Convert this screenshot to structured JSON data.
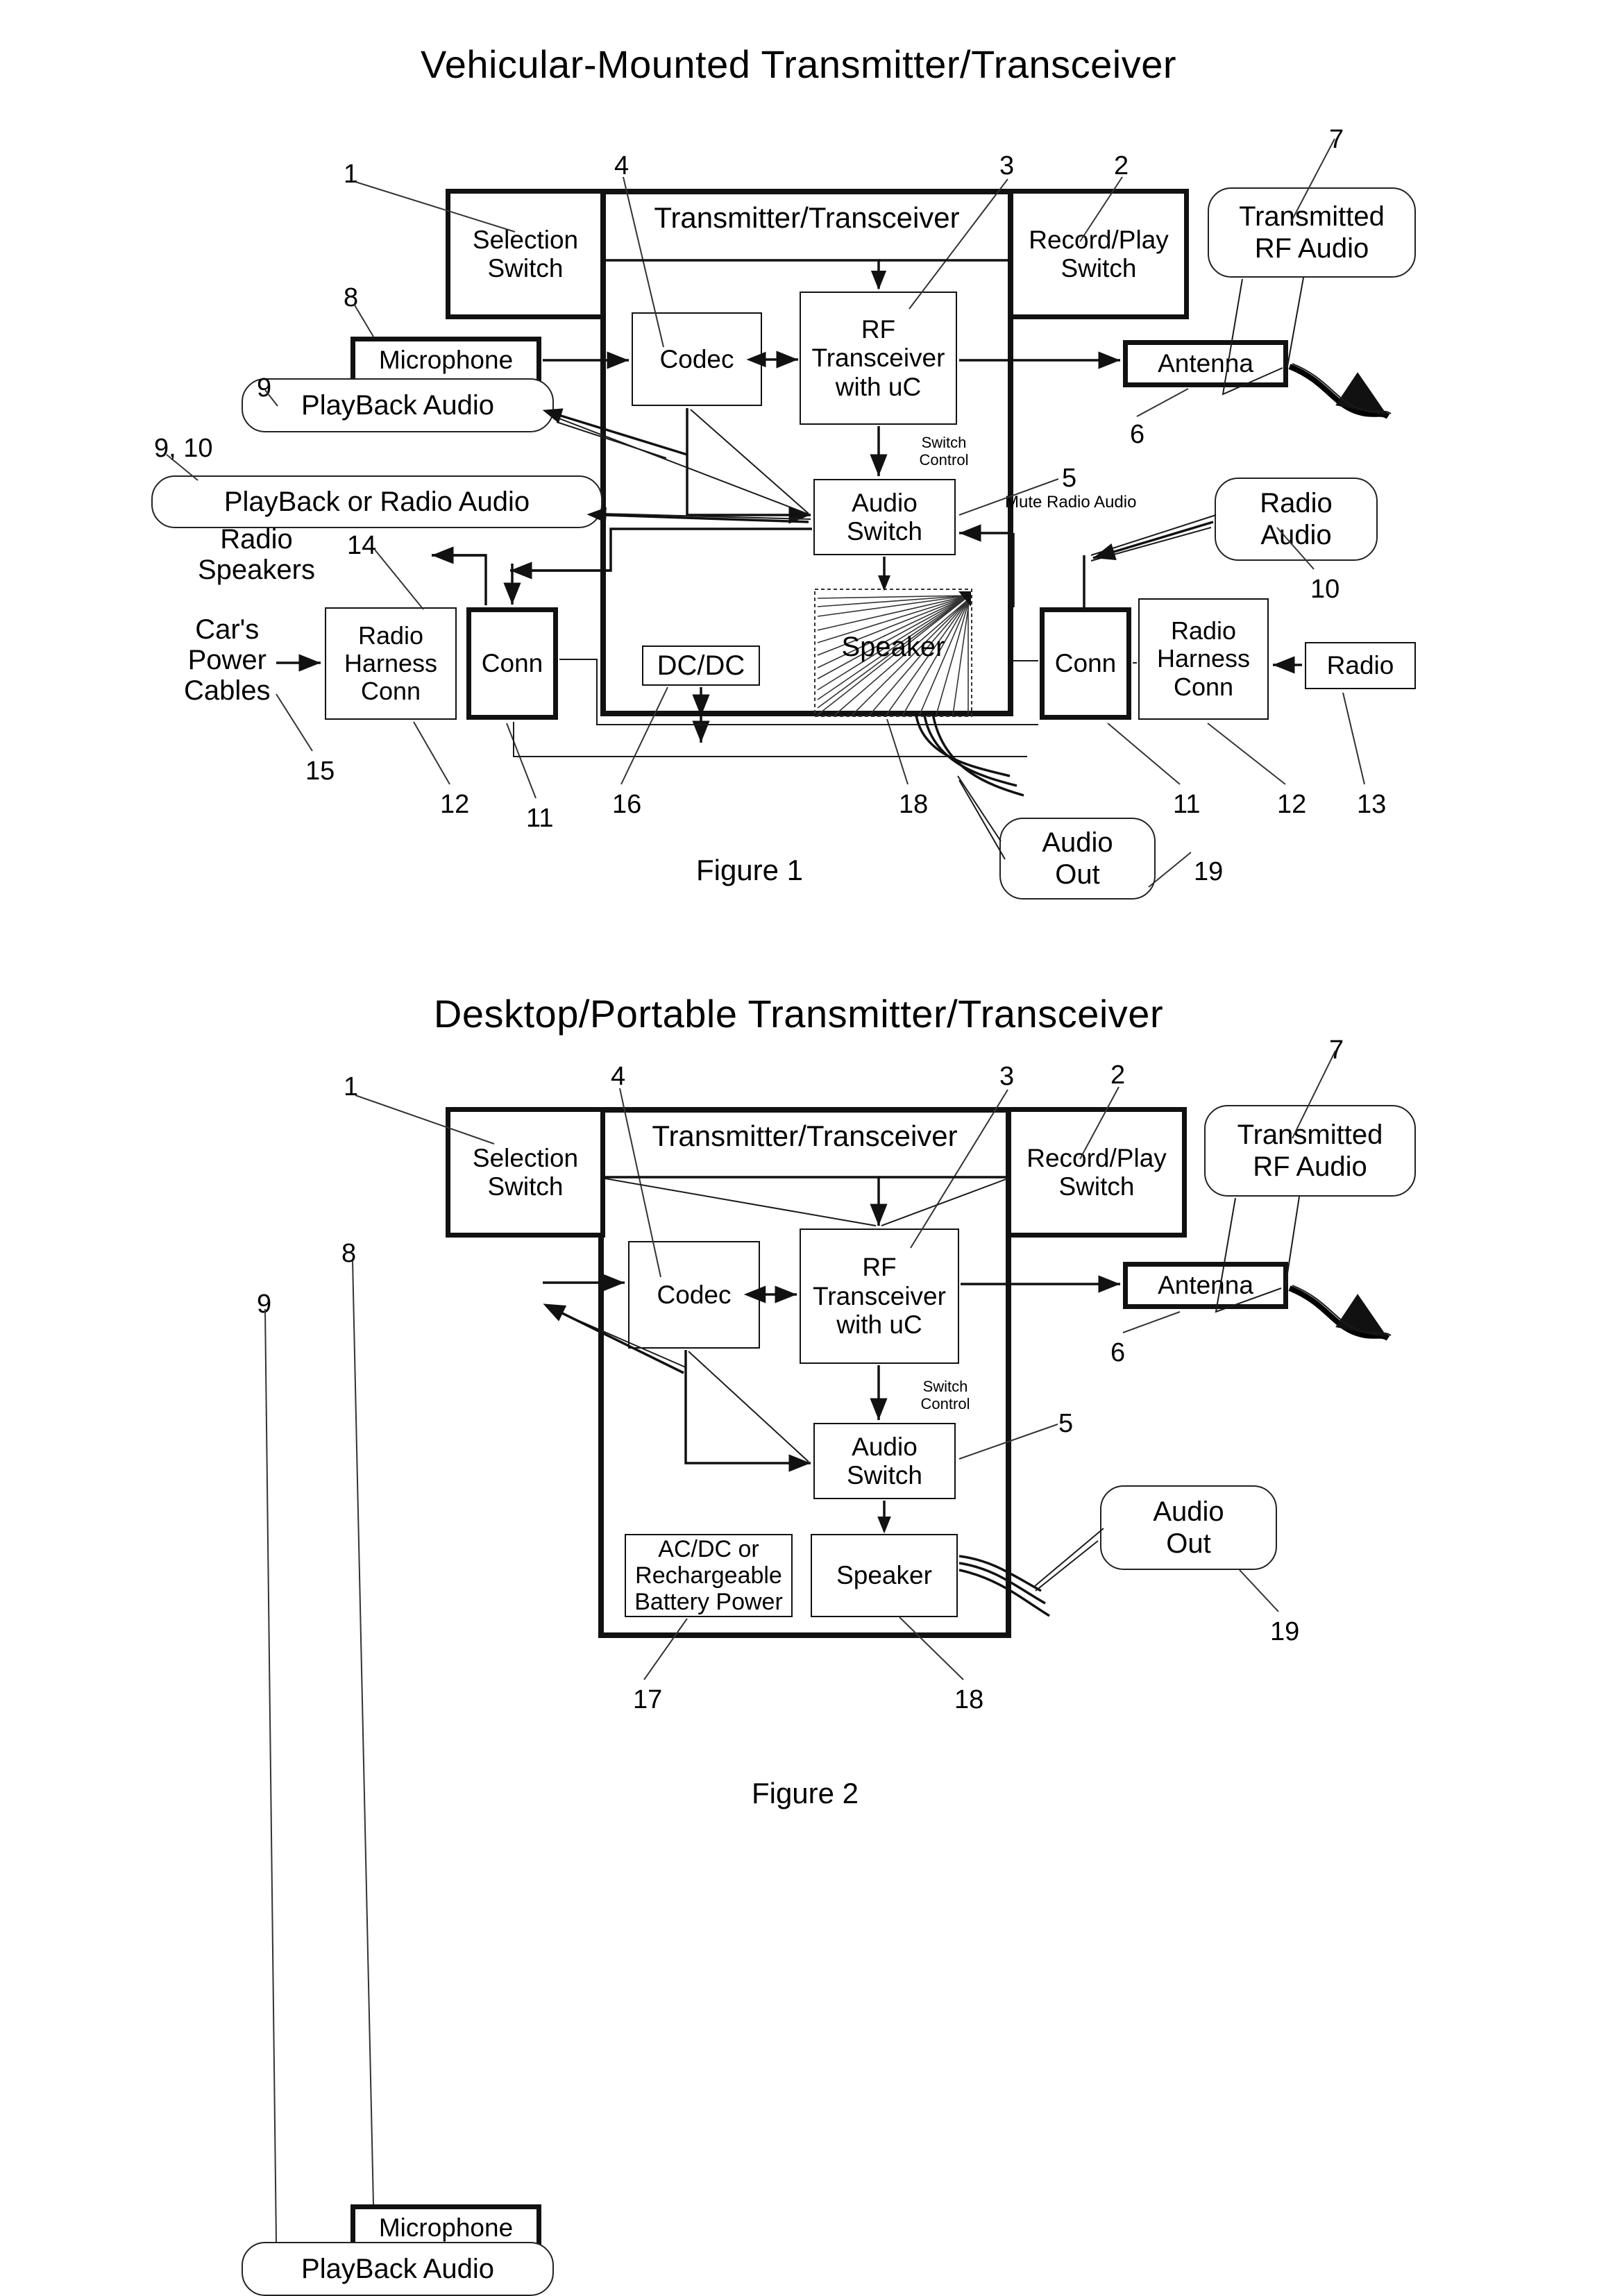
{
  "figure1": {
    "title": "Vehicular-Mounted Transmitter/Transceiver",
    "caption": "Figure 1",
    "outer_box_label": "Transmitter/Transceiver",
    "blocks": {
      "selection_switch": "Selection\nSwitch",
      "record_play_switch": "Record/Play\nSwitch",
      "microphone": "Microphone",
      "codec": "Codec",
      "rf_transceiver": "RF\nTransceiver\nwith uC",
      "audio_switch": "Audio\nSwitch",
      "antenna": "Antenna",
      "speaker": "Speaker",
      "dcdc": "DC/DC",
      "conn_left": "Conn",
      "conn_right": "Conn",
      "radio_harness_conn_left": "Radio\nHarness\nConn",
      "radio_harness_conn_right": "Radio\nHarness\nConn",
      "radio": "Radio"
    },
    "callouts": {
      "transmitted_rf_audio": "Transmitted\nRF Audio",
      "playback_audio": "PlayBack  Audio",
      "playback_or_radio_audio": "PlayBack  or  Radio  Audio",
      "radio_audio": "Radio\nAudio",
      "audio_out": "Audio\nOut"
    },
    "annotations": {
      "switch_control": "Switch\nControl",
      "mute_radio_audio": "Mute Radio Audio",
      "radio_speakers": "Radio\nSpeakers",
      "cars_power_cables": "Car's\nPower\nCables"
    },
    "ref_numerals": {
      "n1": "1",
      "n2": "2",
      "n3": "3",
      "n4": "4",
      "n5": "5",
      "n6": "6",
      "n7": "7",
      "n8": "8",
      "n9": "9",
      "n9_10": "9, 10",
      "n10": "10",
      "n11_left": "11",
      "n11_right": "11",
      "n12_left": "12",
      "n12_right": "12",
      "n13": "13",
      "n14": "14",
      "n15": "15",
      "n16": "16",
      "n18": "18",
      "n19": "19"
    }
  },
  "figure2": {
    "title": "Desktop/Portable Transmitter/Transceiver",
    "caption": "Figure 2",
    "outer_box_label": "Transmitter/Transceiver",
    "blocks": {
      "selection_switch": "Selection\nSwitch",
      "record_play_switch": "Record/Play\nSwitch",
      "microphone": "Microphone",
      "codec": "Codec",
      "rf_transceiver": "RF\nTransceiver\nwith uC",
      "audio_switch": "Audio\nSwitch",
      "antenna": "Antenna",
      "speaker": "Speaker",
      "power": "AC/DC or\nRechargeable\nBattery Power"
    },
    "callouts": {
      "transmitted_rf_audio": "Transmitted\nRF Audio",
      "playback_audio": "PlayBack  Audio",
      "audio_out": "Audio\nOut"
    },
    "annotations": {
      "switch_control": "Switch\nControl"
    },
    "ref_numerals": {
      "n1": "1",
      "n2": "2",
      "n3": "3",
      "n4": "4",
      "n5": "5",
      "n6": "6",
      "n7": "7",
      "n8": "8",
      "n9": "9",
      "n17": "17",
      "n18": "18",
      "n19": "19"
    }
  },
  "colors": {
    "ink": "#111111",
    "background": "#ffffff"
  }
}
